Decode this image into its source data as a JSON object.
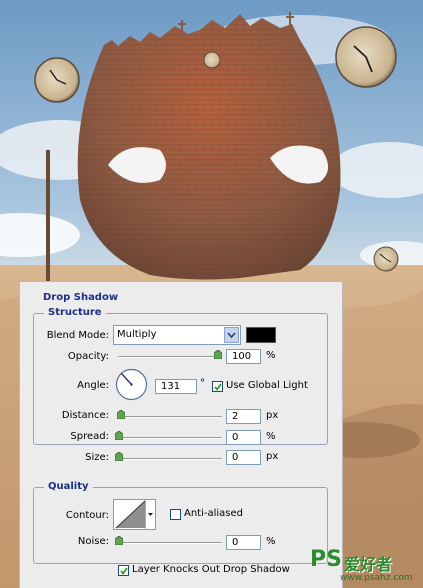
{
  "watermark": {
    "brand": "PS",
    "chinese": "爱好者",
    "url": "www.psahz.com"
  },
  "dialog": {
    "title": "Drop Shadow",
    "structure": {
      "legend": "Structure",
      "blend_mode_label": "Blend Mode:",
      "blend_mode_value": "Multiply",
      "shadow_color": "#000000",
      "opacity_label": "Opacity:",
      "opacity_value": "100",
      "opacity_unit": "%",
      "opacity_level": 1.0,
      "angle_label": "Angle:",
      "angle_value": "131",
      "angle_unit": "°",
      "use_global_light_label": "Use Global Light",
      "use_global_light_checked": true,
      "distance_label": "Distance:",
      "distance_value": "2",
      "distance_unit": "px",
      "spread_label": "Spread:",
      "spread_value": "0",
      "spread_unit": "%",
      "size_label": "Size:",
      "size_value": "0",
      "size_unit": "px"
    },
    "quality": {
      "legend": "Quality",
      "contour_label": "Contour:",
      "anti_aliased_label": "Anti-aliased",
      "anti_aliased_checked": false,
      "noise_label": "Noise:",
      "noise_value": "0",
      "noise_unit": "%"
    },
    "layer_knocks_out_label": "Layer Knocks Out Drop Shadow",
    "layer_knocks_out_checked": true
  },
  "colors": {
    "dialog_bg": "#ececec",
    "title_blue": "#1c2f8a",
    "field_border": "#7f9db9"
  }
}
